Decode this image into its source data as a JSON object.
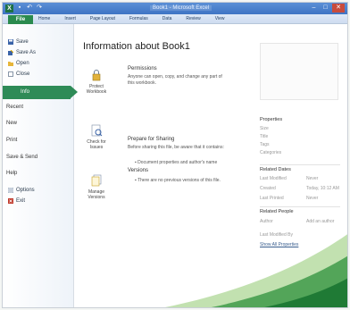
{
  "window": {
    "title": "Book1 - Microsoft Excel",
    "controls": {
      "minimize": "–",
      "maximize": "□",
      "close": "✕"
    }
  },
  "quick_access": [
    "save-icon",
    "undo-icon",
    "redo-icon"
  ],
  "ribbon": {
    "file_tab": "File",
    "tabs": [
      "Home",
      "Insert",
      "Page Layout",
      "Formulas",
      "Data",
      "Review",
      "View"
    ]
  },
  "backstage_nav": {
    "commands": [
      {
        "label": "Save",
        "icon": "save-icon"
      },
      {
        "label": "Save As",
        "icon": "save-as-icon"
      },
      {
        "label": "Open",
        "icon": "open-folder-icon"
      },
      {
        "label": "Close",
        "icon": "close-doc-icon"
      }
    ],
    "active": "Info",
    "sections": [
      "Recent",
      "New",
      "Print",
      "Save & Send",
      "Help"
    ],
    "bottom": [
      {
        "label": "Options",
        "icon": "options-icon"
      },
      {
        "label": "Exit",
        "icon": "exit-icon"
      }
    ]
  },
  "main": {
    "heading": "Information about Book1",
    "blocks": [
      {
        "button": "Protect Workbook",
        "icon": "lock-icon",
        "title": "Permissions",
        "desc": "Anyone can open, copy, and change any part of this workbook."
      },
      {
        "button": "Check for Issues",
        "icon": "check-issues-icon",
        "title": "Prepare for Sharing",
        "desc": "Before sharing this file, be aware that it contains:",
        "bullet": "Document properties and author's name"
      },
      {
        "button": "Manage Versions",
        "icon": "versions-icon",
        "title": "Versions",
        "desc": "",
        "bullet": "There are no previous versions of this file."
      }
    ]
  },
  "properties": {
    "header": "Properties",
    "rows": [
      "Size",
      "Title",
      "Tags",
      "Categories"
    ],
    "related_dates": {
      "header": "Related Dates",
      "rows": [
        {
          "label": "Last Modified",
          "value": "Never"
        },
        {
          "label": "Created",
          "value": "Today, 10:12 AM"
        },
        {
          "label": "Last Printed",
          "value": "Never"
        }
      ]
    },
    "related_people": {
      "header": "Related People",
      "rows": [
        {
          "label": "Author",
          "value": "Add an author"
        }
      ]
    },
    "last_modified_by": "Last Modified By",
    "show_all": "Show All Properties"
  },
  "colors": {
    "accent": "#2e8b57",
    "titlebar": "#3e74c4"
  }
}
